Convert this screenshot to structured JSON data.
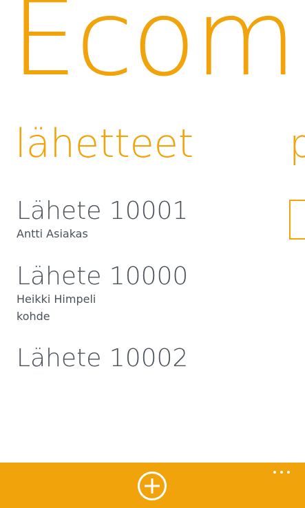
{
  "app": {
    "title": "Ecom"
  },
  "panorama": {
    "current_section": "lähetteet",
    "next_section_peek": "p"
  },
  "list": {
    "items": [
      {
        "title": "Lähete 10001",
        "lines": [
          "Antti Asiakas"
        ]
      },
      {
        "title": "Lähete 10000",
        "lines": [
          "Heikki Himpeli",
          "kohde"
        ]
      },
      {
        "title": "Lähete 10002",
        "lines": []
      }
    ]
  },
  "app_bar": {
    "add_icon": "add-circle-icon",
    "more_icon": "ellipsis-icon"
  },
  "colors": {
    "accent": "#f0a30a",
    "text": "#4b5259",
    "background": "#ffffff",
    "app_bar_icon": "#ffffff"
  }
}
